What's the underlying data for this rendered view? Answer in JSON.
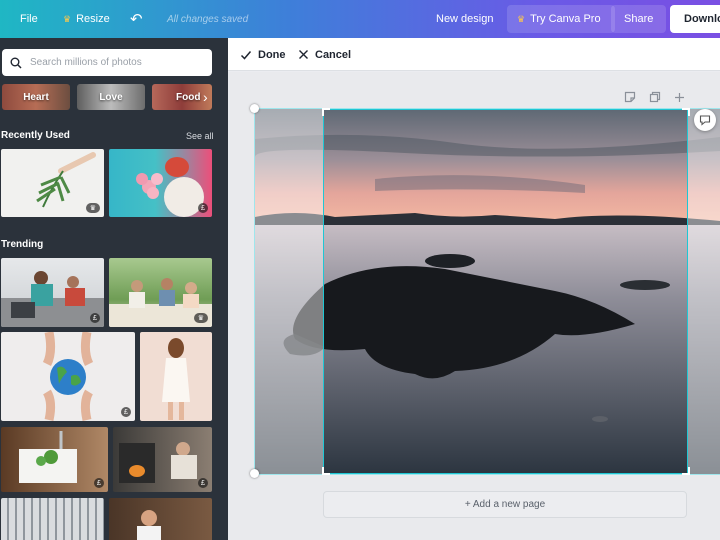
{
  "topbar": {
    "file": "File",
    "resize": "Resize",
    "saved_status": "All changes saved",
    "new_design": "New design",
    "try_pro": "Try Canva Pro",
    "share": "Share",
    "download": "Download"
  },
  "sidebar": {
    "search_placeholder": "Search millions of photos",
    "tags": [
      "Heart",
      "Love",
      "Food"
    ],
    "recently_used": "Recently Used",
    "see_all": "See all",
    "trending": "Trending"
  },
  "editbar": {
    "done": "Done",
    "cancel": "Cancel"
  },
  "canvas": {
    "add_page": "+ Add a new page"
  },
  "icons": [
    "crown-icon",
    "undo-icon",
    "download-icon",
    "search-icon",
    "check-icon",
    "close-icon",
    "note-icon",
    "duplicate-icon",
    "add-icon",
    "comment-icon",
    "chevron-right-icon",
    "chevron-left-icon"
  ],
  "colors": {
    "gradient_start": "#1fb7c4",
    "gradient_end": "#7a4fe3",
    "sidebar_bg": "#2b323b",
    "crop_accent": "#1fc7d4"
  }
}
